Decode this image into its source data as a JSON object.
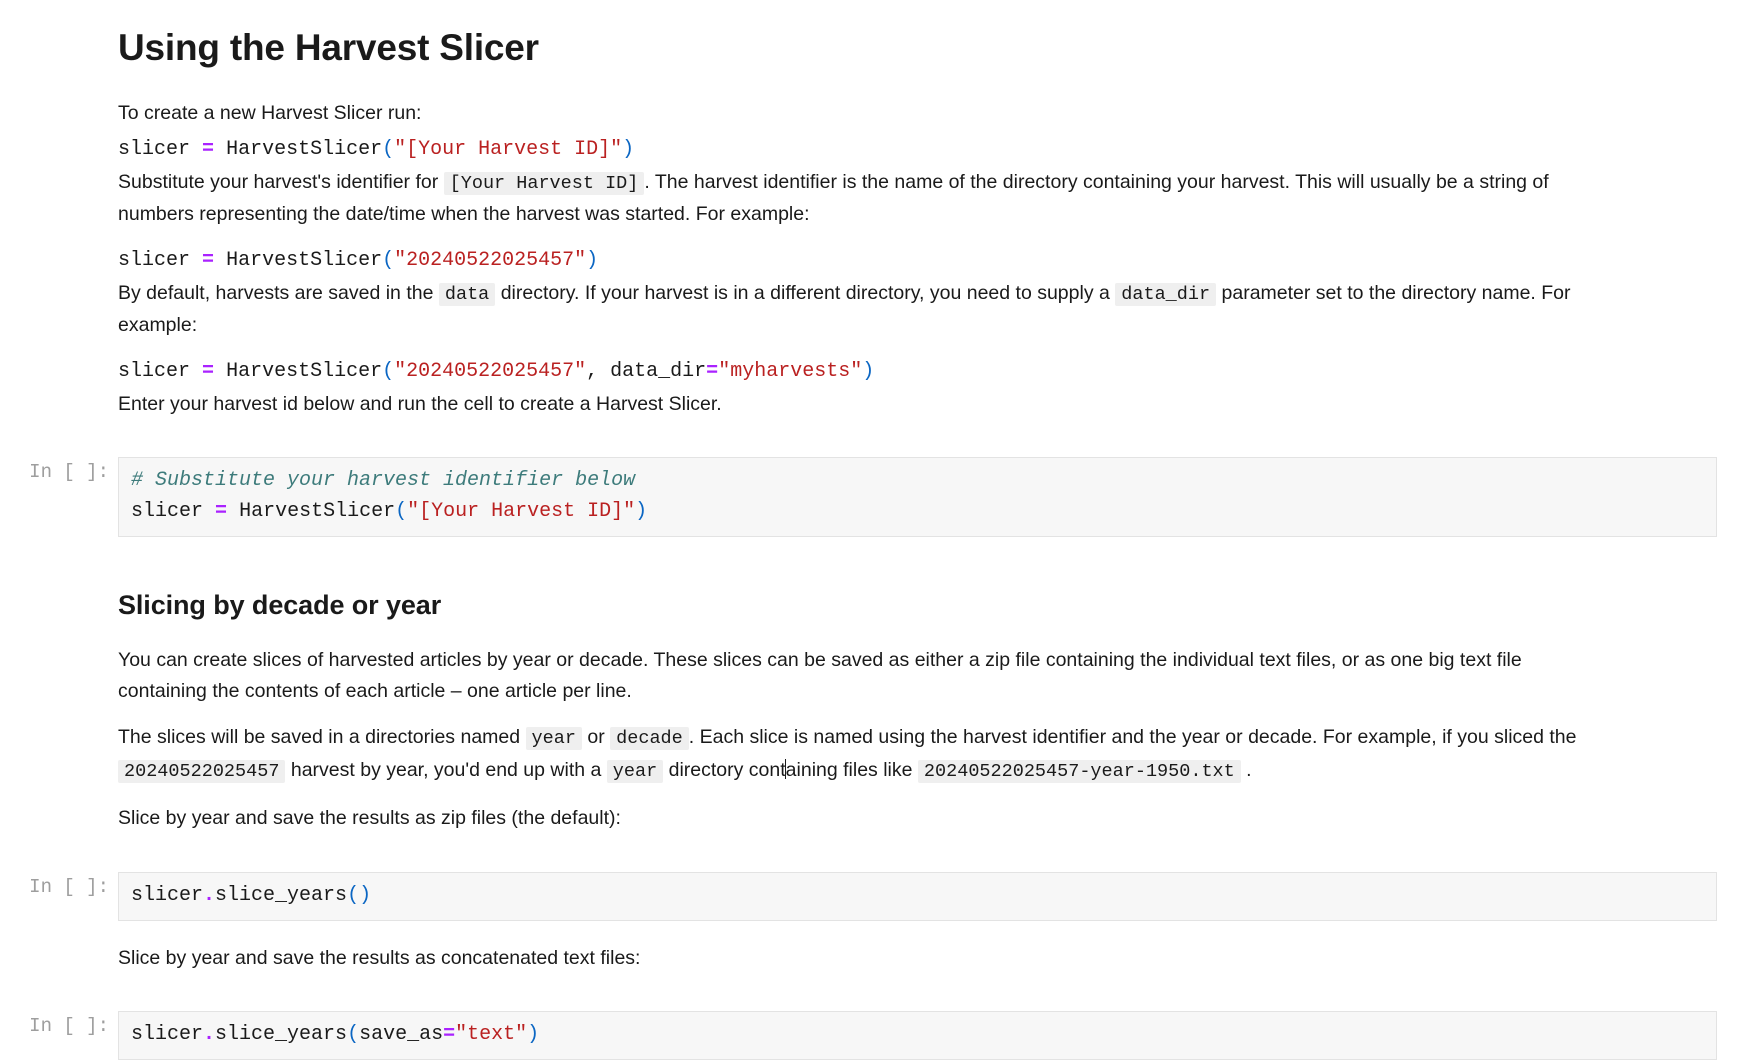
{
  "document": {
    "title": "Using the Harvest Slicer",
    "subtitle": "Slicing by decade or year"
  },
  "intro": {
    "lead": "To create a new Harvest Slicer run:",
    "code_1": {
      "var": "slicer",
      "assign": "=",
      "call": "HarvestSlicer",
      "open": "(",
      "string": "\"[Your Harvest ID]\"",
      "close": ")"
    },
    "para_1_before": "Substitute your harvest's identifier for ",
    "para_1_code": "[Your Harvest ID]",
    "para_1_after": ". The harvest identifier is the name of the directory containing your harvest. This will usually be a string of numbers representing the date/time when the harvest was started. For example:",
    "code_2": {
      "var": "slicer",
      "assign": "=",
      "call": "HarvestSlicer",
      "open": "(",
      "string": "\"20240522025457\"",
      "close": ")"
    },
    "para_2_a": "By default, harvests are saved in the ",
    "para_2_code_1": "data",
    "para_2_b": " directory. If your harvest is in a different directory, you need to supply a ",
    "para_2_code_2": "data_dir",
    "para_2_c": " parameter set to the directory name. For example:",
    "code_3": {
      "var": "slicer",
      "assign": "=",
      "call": "HarvestSlicer",
      "open": "(",
      "string1": "\"20240522025457\"",
      "comma": ", ",
      "kwarg": "data_dir",
      "eq": "=",
      "string2": "\"myharvests\"",
      "close": ")"
    },
    "para_3": "Enter your harvest id below and run the cell to create a Harvest Slicer."
  },
  "cells": [
    {
      "prompt": "In [ ]:",
      "name": "create-slicer-cell",
      "comment": "# Substitute your harvest identifier below",
      "var": "slicer",
      "assign": "=",
      "call": "HarvestSlicer",
      "open": "(",
      "string": "\"[Your Harvest ID]\"",
      "close": ")"
    },
    {
      "prompt": "In [ ]:",
      "name": "slice-years-zip-cell",
      "obj": "slicer",
      "dot": ".",
      "method": "slice_years",
      "parens": "()"
    },
    {
      "prompt": "In [ ]:",
      "name": "slice-years-text-cell",
      "obj": "slicer",
      "dot": ".",
      "method": "slice_years",
      "open": "(",
      "kwarg": "save_as",
      "eq": "=",
      "string": "\"text\"",
      "close": ")"
    }
  ],
  "slicing": {
    "para_1": "You can create slices of harvested articles by year or decade. These slices can be saved as either a zip file containing the individual text files, or as one big text file containing the contents of each article – one article per line.",
    "para_2_a": "The slices will be saved in a directories named ",
    "para_2_code_1": "year",
    "para_2_b": " or ",
    "para_2_code_2": "decade",
    "para_2_c": ". Each slice is named using the harvest identifier and the year or decade. For example, if you sliced the ",
    "para_2_code_3": "20240522025457",
    "para_2_d": " harvest by year, you'd end up with a ",
    "para_2_code_4": "year",
    "para_2_e_before_caret": " directory cont",
    "para_2_e_after_caret": "aining files like ",
    "para_2_code_5": "20240522025457-year-1950.txt",
    "para_2_f": " .",
    "para_3": "Slice by year and save the results as zip files (the default):",
    "para_4": "Slice by year and save the results as concatenated text files:"
  },
  "colors": {
    "operator": "#aa22ff",
    "string": "#ba2121",
    "punctuation": "#0b66c3",
    "comment": "#3d7b7b",
    "cell_background": "#f7f7f7",
    "inline_code_background": "#efefef",
    "prompt": "#9e9e9e"
  }
}
